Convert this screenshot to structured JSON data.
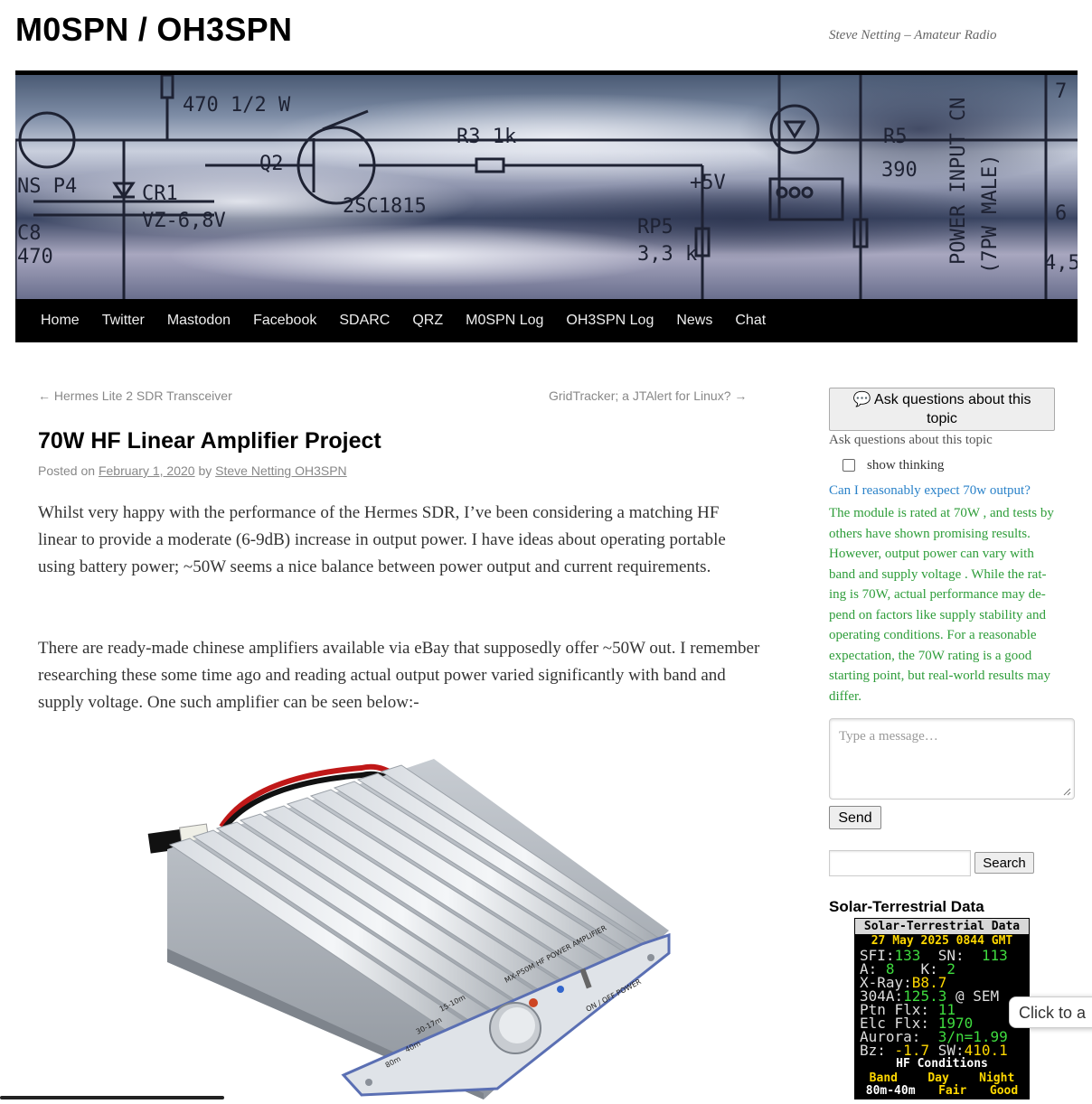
{
  "site": {
    "title": "M0SPN / OH3SPN",
    "description": "Steve Netting – Amateur Radio"
  },
  "banner": {
    "labels": [
      "470 1/2 W",
      "R3 1k",
      "Q2",
      "NS P4",
      "CR1",
      "VZ-6,8V",
      "C8",
      "470",
      "2SC1815",
      "+5V",
      "RP5",
      "3,3 k",
      "R5",
      "390",
      "POWER INPUT CN",
      "(7PW MALE)",
      "7",
      "6",
      "4,5"
    ]
  },
  "nav": {
    "items": [
      "Home",
      "Twitter",
      "Mastodon",
      "Facebook",
      "SDARC",
      "QRZ",
      "M0SPN Log",
      "OH3SPN Log",
      "News",
      "Chat"
    ]
  },
  "post": {
    "prev": "← Hermes Lite 2 SDR Transceiver",
    "next": "GridTracker; a JTAlert for Linux? →",
    "title": "70W HF Linear Amplifier Project",
    "posted_on": "Posted on",
    "date": "February 1, 2020",
    "by": "by",
    "author": "Steve Netting OH3SPN",
    "paragraph1": "Whilst very happy with the performance of the Hermes SDR, I’ve been considering a matching HF linear to provide a moderate (6-9dB) increase in output power. I have ideas about operating portable using battery power; ~50W seems a nice balance between power output and current requirements.",
    "paragraph2": "There are ready-made chinese amplifiers available via eBay that supposedly offer ~50W out. I remember researching these some time ago and reading actual output power varied significantly with band and supply voltage. One such amplifier can be seen below:-",
    "image_labels": {
      "model": "MX-P50M HF POWER AMPLIFIER",
      "bands": [
        "15-10m",
        "30-17m",
        "40m",
        "80m"
      ],
      "switch": "ON / OFF POWER"
    }
  },
  "sidebar": {
    "ask_button": "💬 Ask questions about this topic",
    "ask_label": "Ask questions about this topic",
    "show_thinking": "show thinking",
    "question": "Can I reasonably expect 70w output?",
    "answer": "The module is rated at 70W , and tests by others have shown promising results. However, output power can vary with band and supply voltage . While the rat­ing is 70W, actual performance may de­pend on factors like supply stability and operating conditions. For a reasonable expectation, the 70W rating is a good starting point, but real-world results may differ.",
    "message_placeholder": "Type a message…",
    "send": "Send",
    "search_button": "Search",
    "widget_title": "Solar-Terrestrial Data"
  },
  "solar": {
    "header": "Solar-Terrestrial Data",
    "date": "27 May 2025 0844 GMT",
    "sfi_label": "SFI:",
    "sfi": "133",
    "sn_label": "SN:",
    "sn": "113",
    "a_label": "A:",
    "a": "8",
    "k_label": "K:",
    "k": "2",
    "xray_label": "X-Ray:",
    "xray": "B8.7",
    "sem_label": "304A:",
    "sem": "125.3",
    "sem_unit": "@ SEM",
    "ptn_label": "Ptn Flx:",
    "ptn": "11",
    "elc_label": "Elc Flx:",
    "elc": "1970",
    "aurora_label": "Aurora:",
    "aurora": "3/n=1.99",
    "bz_label": "Bz:",
    "bz": "-1.7",
    "sw_label": "SW:",
    "sw": "410.1",
    "hf_title": "HF Conditions",
    "col_band": "Band",
    "col_day": "Day",
    "col_night": "Night",
    "row1_band": "80m-40m",
    "row1_day": "Fair",
    "row1_night": "Good"
  },
  "chat_bubble": "Click to a"
}
